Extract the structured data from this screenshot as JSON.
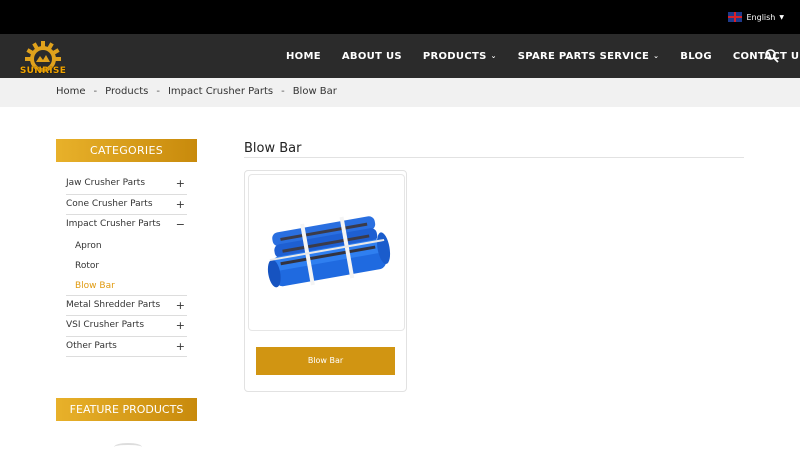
{
  "topbar": {
    "language": "English"
  },
  "header": {
    "logo_text": "SUNRISE",
    "nav": [
      {
        "label": "HOME",
        "has_dropdown": false
      },
      {
        "label": "ABOUT US",
        "has_dropdown": false
      },
      {
        "label": "PRODUCTS",
        "has_dropdown": true
      },
      {
        "label": "SPARE PARTS SERVICE",
        "has_dropdown": true
      },
      {
        "label": "BLOG",
        "has_dropdown": false
      },
      {
        "label": "CONTACT US",
        "has_dropdown": false
      }
    ],
    "search_icon": "search-icon"
  },
  "breadcrumb": [
    "Home",
    "Products",
    "Impact Crusher Parts",
    "Blow Bar"
  ],
  "breadcrumb_sep": "-",
  "sidebar": {
    "categories_title": "CATEGORIES",
    "items": [
      {
        "label": "Jaw Crusher Parts",
        "toggle": "+"
      },
      {
        "label": "Cone Crusher Parts",
        "toggle": "+"
      },
      {
        "label": "Impact Crusher Parts",
        "toggle": "−"
      },
      {
        "label": "Metal Shredder Parts",
        "toggle": "+"
      },
      {
        "label": "VSI Crusher Parts",
        "toggle": "+"
      },
      {
        "label": "Other Parts",
        "toggle": "+"
      }
    ],
    "sub_items": [
      "Apron",
      "Rotor",
      "Blow Bar"
    ],
    "feature_title": "FEATURE PRODUCTS"
  },
  "main": {
    "title": "Blow Bar",
    "products": [
      {
        "label": "Blow Bar"
      }
    ]
  },
  "colors": {
    "accent": "#d19512",
    "nav_bg": "#2b2b2b",
    "topbar_bg": "#000000",
    "active_link": "#e09a10",
    "product_blue": "#1f6fe6"
  }
}
